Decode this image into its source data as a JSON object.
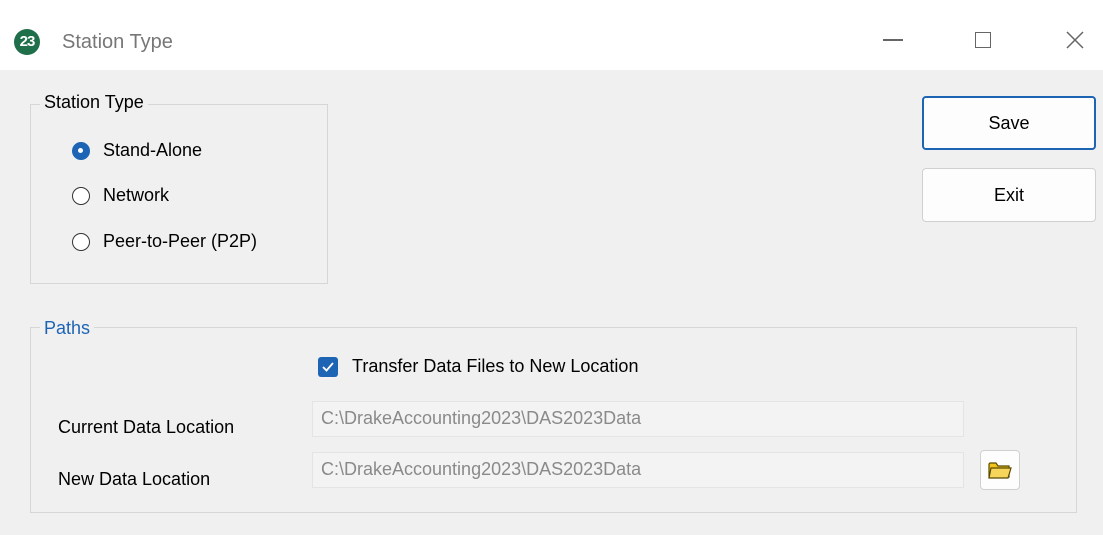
{
  "window": {
    "title": "Station Type",
    "app_icon_text": "23"
  },
  "station_type": {
    "legend": "Station Type",
    "options": [
      {
        "label": "Stand-Alone",
        "selected": true
      },
      {
        "label": "Network",
        "selected": false
      },
      {
        "label": "Peer-to-Peer (P2P)",
        "selected": false
      }
    ]
  },
  "buttons": {
    "save_label": "Save",
    "exit_label": "Exit"
  },
  "paths": {
    "legend": "Paths",
    "transfer_label": "Transfer Data Files to New Location",
    "transfer_checked": true,
    "current_label": "Current Data Location",
    "current_value": "C:\\DrakeAccounting2023\\DAS2023Data",
    "new_label": "New Data Location",
    "new_value": "C:\\DrakeAccounting2023\\DAS2023Data"
  },
  "colors": {
    "accent": "#1e64b4",
    "app_icon": "#1f6f4a",
    "folder_icon": "#f0c419"
  }
}
